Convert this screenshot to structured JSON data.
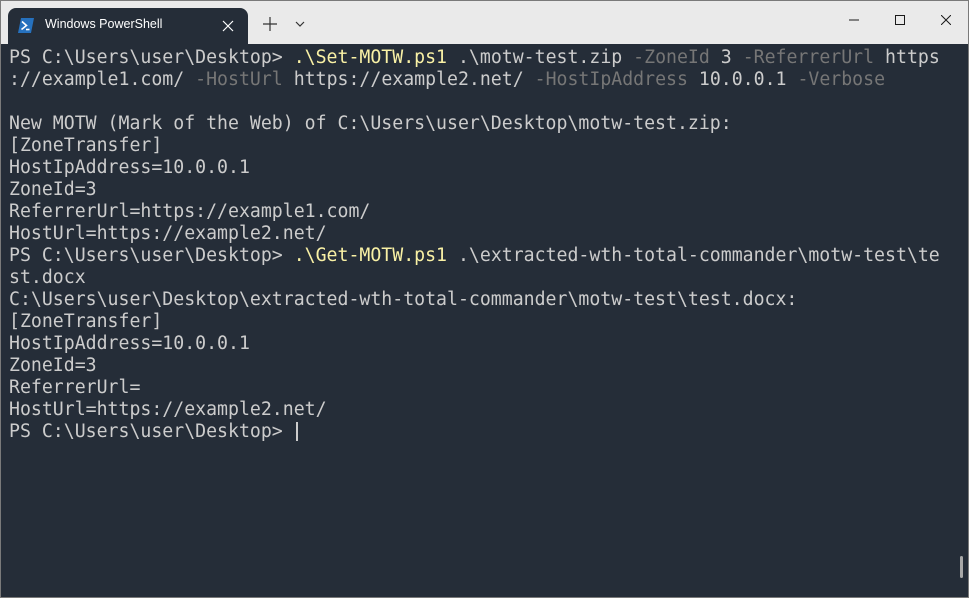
{
  "window": {
    "tab_title": "Windows PowerShell",
    "tab_icon": "powershell-icon",
    "new_tab_icon": "plus-icon",
    "dropdown_icon": "chevron-down-icon",
    "controls": [
      "minimize-icon",
      "maximize-icon",
      "close-icon"
    ]
  },
  "colors": {
    "background": "#252d38",
    "text": "#cccccc",
    "command": "#f9f1a5",
    "parameter": "#767676",
    "titlebar": "#eaeaea",
    "powershell_blue": "#2671be"
  },
  "terminal": {
    "lines": [
      {
        "segments": [
          {
            "t": "PS C:\\Users\\user\\Desktop> ",
            "c": "text"
          },
          {
            "t": ".\\Set-MOTW.ps1",
            "c": "command"
          },
          {
            "t": " .\\motw-test.zip ",
            "c": "text"
          },
          {
            "t": "-ZoneId",
            "c": "parameter"
          },
          {
            "t": " 3 ",
            "c": "text"
          },
          {
            "t": "-ReferrerUrl",
            "c": "parameter"
          },
          {
            "t": " https",
            "c": "text"
          }
        ]
      },
      {
        "segments": [
          {
            "t": "://example1.com/ ",
            "c": "text"
          },
          {
            "t": "-HostUrl",
            "c": "parameter"
          },
          {
            "t": " https://example2.net/ ",
            "c": "text"
          },
          {
            "t": "-HostIpAddress",
            "c": "parameter"
          },
          {
            "t": " 10.0.0.1 ",
            "c": "text"
          },
          {
            "t": "-Verbose",
            "c": "parameter"
          }
        ]
      },
      {
        "segments": [
          {
            "t": "",
            "c": "text"
          }
        ]
      },
      {
        "segments": [
          {
            "t": "New MOTW (Mark of the Web) of C:\\Users\\user\\Desktop\\motw-test.zip:",
            "c": "text"
          }
        ]
      },
      {
        "segments": [
          {
            "t": "[ZoneTransfer]",
            "c": "text"
          }
        ]
      },
      {
        "segments": [
          {
            "t": "HostIpAddress=10.0.0.1",
            "c": "text"
          }
        ]
      },
      {
        "segments": [
          {
            "t": "ZoneId=3",
            "c": "text"
          }
        ]
      },
      {
        "segments": [
          {
            "t": "ReferrerUrl=https://example1.com/",
            "c": "text"
          }
        ]
      },
      {
        "segments": [
          {
            "t": "HostUrl=https://example2.net/",
            "c": "text"
          }
        ]
      },
      {
        "segments": [
          {
            "t": "PS C:\\Users\\user\\Desktop> ",
            "c": "text"
          },
          {
            "t": ".\\Get-MOTW.ps1",
            "c": "command"
          },
          {
            "t": " .\\extracted-wth-total-commander\\motw-test\\te",
            "c": "text"
          }
        ]
      },
      {
        "segments": [
          {
            "t": "st.docx",
            "c": "text"
          }
        ]
      },
      {
        "segments": [
          {
            "t": "C:\\Users\\user\\Desktop\\extracted-wth-total-commander\\motw-test\\test.docx:",
            "c": "text"
          }
        ]
      },
      {
        "segments": [
          {
            "t": "[ZoneTransfer]",
            "c": "text"
          }
        ]
      },
      {
        "segments": [
          {
            "t": "HostIpAddress=10.0.0.1",
            "c": "text"
          }
        ]
      },
      {
        "segments": [
          {
            "t": "ZoneId=3",
            "c": "text"
          }
        ]
      },
      {
        "segments": [
          {
            "t": "ReferrerUrl=",
            "c": "text"
          }
        ]
      },
      {
        "segments": [
          {
            "t": "HostUrl=https://example2.net/",
            "c": "text"
          }
        ]
      },
      {
        "segments": [
          {
            "t": "PS C:\\Users\\user\\Desktop> ",
            "c": "text"
          }
        ],
        "cursor": true
      }
    ]
  }
}
